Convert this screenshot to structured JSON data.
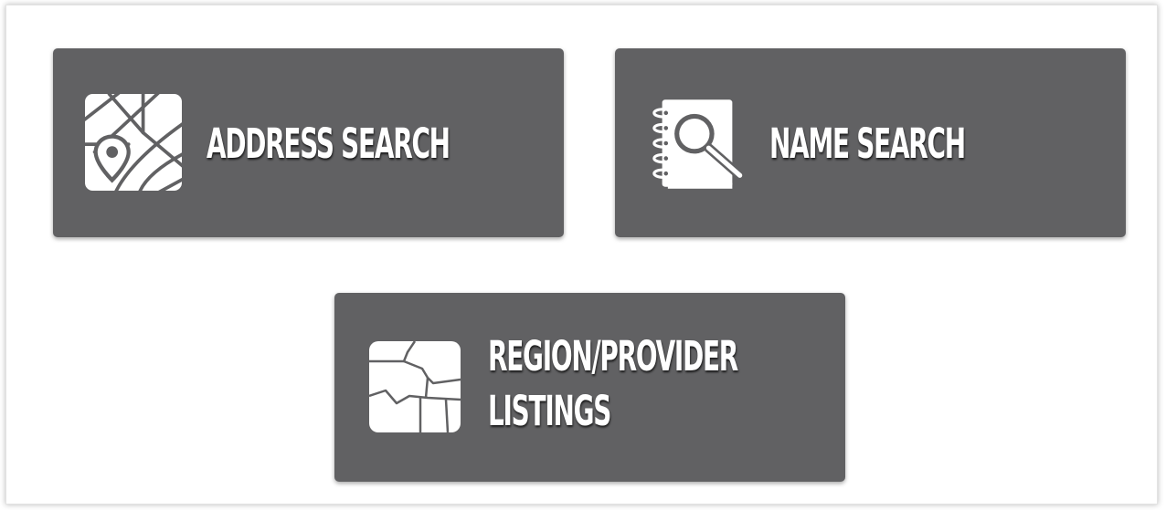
{
  "tiles": {
    "address": {
      "label": "ADDRESS SEARCH",
      "icon": "map-pin-icon"
    },
    "name": {
      "label": "NAME SEARCH",
      "icon": "notebook-search-icon"
    },
    "region": {
      "label_line1": "REGION/PROVIDER",
      "label_line2": "LISTINGS",
      "icon": "region-map-icon"
    }
  },
  "colors": {
    "tile_background": "#616163",
    "tile_text": "#ffffff",
    "page_background": "#ffffff"
  }
}
